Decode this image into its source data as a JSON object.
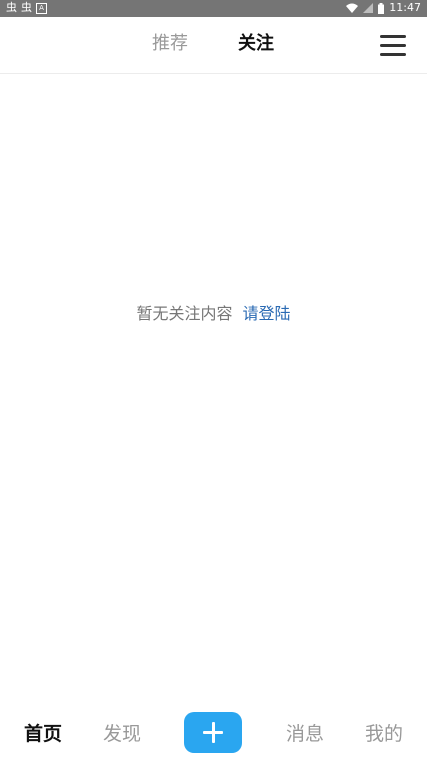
{
  "status": {
    "left_icons": [
      "bug-icon",
      "bug-icon",
      "a-icon"
    ],
    "time": "11:47"
  },
  "header": {
    "tabs": [
      {
        "label": "推荐"
      },
      {
        "label": "关注"
      }
    ],
    "menu_icon": "menu-icon"
  },
  "main": {
    "empty_message": "暂无关注内容",
    "login_link": "请登陆"
  },
  "bottom_nav": {
    "items": [
      {
        "label": "首页"
      },
      {
        "label": "发现"
      },
      {
        "label": "消息"
      },
      {
        "label": "我的"
      }
    ],
    "add_icon": "plus-icon",
    "accent": "#2aa6f0"
  }
}
